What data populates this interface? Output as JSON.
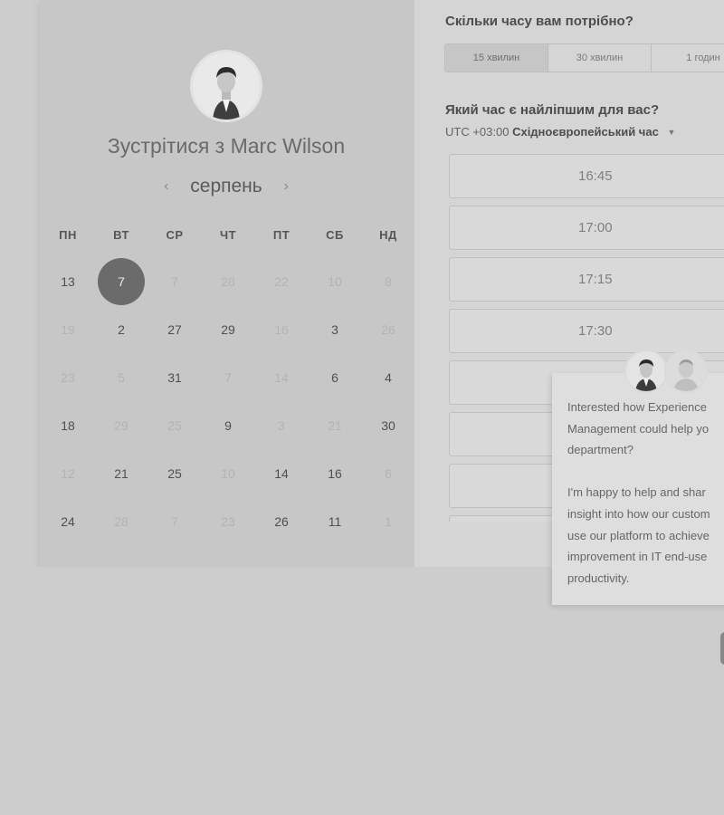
{
  "booking": {
    "title": "Зустрітися з Marc Wilson",
    "month": "серпень",
    "prev_arrow": "‹",
    "next_arrow": "›",
    "weekdays": [
      "ПН",
      "ВТ",
      "СР",
      "ЧТ",
      "ПТ",
      "СБ",
      "НД"
    ],
    "weeks": [
      [
        {
          "d": "13",
          "m": false
        },
        {
          "d": "7",
          "m": false,
          "sel": true
        },
        {
          "d": "7",
          "m": true
        },
        {
          "d": "28",
          "m": true
        },
        {
          "d": "22",
          "m": true
        },
        {
          "d": "10",
          "m": true
        },
        {
          "d": "8",
          "m": true
        }
      ],
      [
        {
          "d": "19",
          "m": true
        },
        {
          "d": "2",
          "m": false
        },
        {
          "d": "27",
          "m": false
        },
        {
          "d": "29",
          "m": false
        },
        {
          "d": "16",
          "m": true
        },
        {
          "d": "3",
          "m": false
        },
        {
          "d": "26",
          "m": true
        }
      ],
      [
        {
          "d": "23",
          "m": true
        },
        {
          "d": "5",
          "m": true
        },
        {
          "d": "31",
          "m": false
        },
        {
          "d": "7",
          "m": true
        },
        {
          "d": "14",
          "m": true
        },
        {
          "d": "6",
          "m": false
        },
        {
          "d": "4",
          "m": false
        }
      ],
      [
        {
          "d": "18",
          "m": false
        },
        {
          "d": "29",
          "m": true
        },
        {
          "d": "25",
          "m": true
        },
        {
          "d": "9",
          "m": false
        },
        {
          "d": "3",
          "m": true
        },
        {
          "d": "21",
          "m": true
        },
        {
          "d": "30",
          "m": false
        }
      ],
      [
        {
          "d": "12",
          "m": true
        },
        {
          "d": "21",
          "m": false
        },
        {
          "d": "25",
          "m": false
        },
        {
          "d": "10",
          "m": true
        },
        {
          "d": "14",
          "m": false
        },
        {
          "d": "16",
          "m": false
        },
        {
          "d": "6",
          "m": true
        }
      ],
      [
        {
          "d": "24",
          "m": false
        },
        {
          "d": "28",
          "m": true
        },
        {
          "d": "7",
          "m": true
        },
        {
          "d": "23",
          "m": true
        },
        {
          "d": "26",
          "m": false
        },
        {
          "d": "11",
          "m": false
        },
        {
          "d": "1",
          "m": true
        }
      ]
    ]
  },
  "duration": {
    "question": "Скільки часу вам потрібно?",
    "options": [
      "15 хвилин",
      "30 хвилин",
      "1 годин"
    ],
    "selected_index": 0
  },
  "time": {
    "question": "Який час є найліпшим для вас?",
    "tz_prefix": "UTC +03:00",
    "tz_name": "Східноєвропейський час",
    "slots": [
      "16:45",
      "17:00",
      "17:15",
      "17:30",
      "",
      "",
      "",
      ""
    ]
  },
  "chat": {
    "lines": [
      "Interested how Experience",
      "Management could help yo",
      "department?",
      "",
      "I'm happy to help and shar",
      "insight into how our custom",
      "use our platform to achieve",
      "improvement in IT end-use",
      "productivity."
    ]
  }
}
